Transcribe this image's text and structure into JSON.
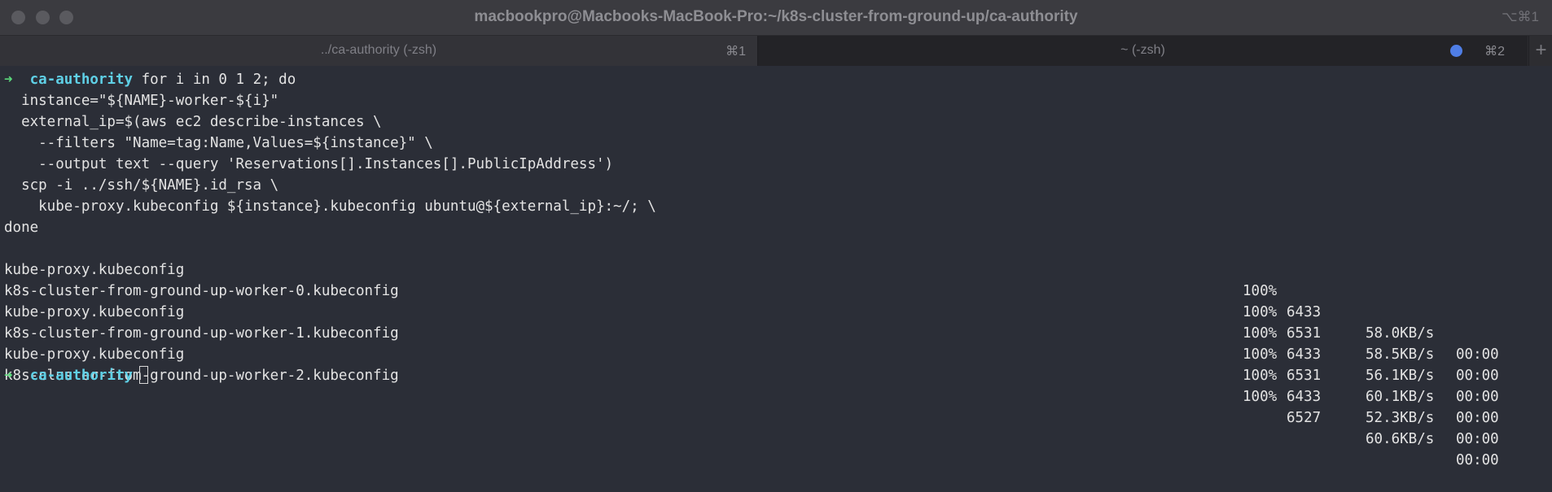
{
  "window": {
    "title": "macbookpro@Macbooks-MacBook-Pro:~/k8s-cluster-from-ground-up/ca-authority",
    "shortcut": "⌥⌘1"
  },
  "tabs": [
    {
      "label": "../ca-authority (-zsh)",
      "shortcut": "⌘1"
    },
    {
      "label": "~ (-zsh)",
      "shortcut": "⌘2"
    }
  ],
  "new_tab_label": "+",
  "prompt": {
    "arrow": "➜",
    "directory": "ca-authority"
  },
  "command": {
    "first_line": "for i in 0 1 2; do",
    "lines": [
      "  instance=\"${NAME}-worker-${i}\"",
      "  external_ip=$(aws ec2 describe-instances \\",
      "    --filters \"Name=tag:Name,Values=${instance}\" \\",
      "    --output text --query 'Reservations[].Instances[].PublicIpAddress')",
      "  scp -i ../ssh/${NAME}.id_rsa \\",
      "    kube-proxy.kubeconfig ${instance}.kubeconfig ubuntu@${external_ip}:~/; \\",
      "done"
    ]
  },
  "transfers": [
    {
      "file": "kube-proxy.kubeconfig",
      "percent": "100%",
      "bytes": "6433",
      "rate": "58.0KB/s",
      "time": "00:00"
    },
    {
      "file": "k8s-cluster-from-ground-up-worker-0.kubeconfig",
      "percent": "100%",
      "bytes": "6531",
      "rate": "58.5KB/s",
      "time": "00:00"
    },
    {
      "file": "kube-proxy.kubeconfig",
      "percent": "100%",
      "bytes": "6433",
      "rate": "56.1KB/s",
      "time": "00:00"
    },
    {
      "file": "k8s-cluster-from-ground-up-worker-1.kubeconfig",
      "percent": "100%",
      "bytes": "6531",
      "rate": "60.1KB/s",
      "time": "00:00"
    },
    {
      "file": "kube-proxy.kubeconfig",
      "percent": "100%",
      "bytes": "6433",
      "rate": "52.3KB/s",
      "time": "00:00"
    },
    {
      "file": "k8s-cluster-from-ground-up-worker-2.kubeconfig",
      "percent": "100%",
      "bytes": "6527",
      "rate": "60.6KB/s",
      "time": "00:00"
    }
  ],
  "colors": {
    "background": "#2b2e37",
    "prompt_arrow": "#5ad77a",
    "prompt_dir": "#5fd0e6",
    "text": "#e3e3e3",
    "tab_indicator": "#4f7ee6"
  }
}
